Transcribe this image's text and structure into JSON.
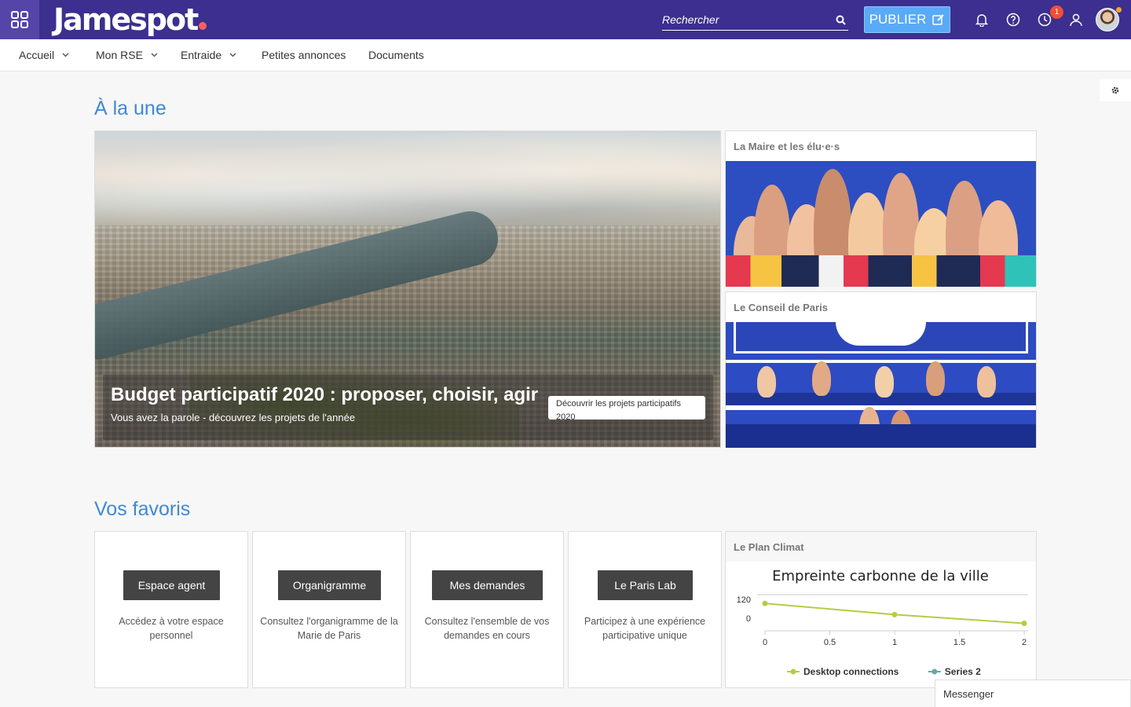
{
  "header": {
    "logo_text": "Jamespot",
    "search_placeholder": "Rechercher",
    "publish_label": "PUBLIER",
    "notif_count": "1",
    "colors": {
      "topbar": "#3c2f8f",
      "accent": "#3f88d6",
      "publish": "#59aaf7",
      "badge": "#f04e37"
    }
  },
  "nav": {
    "items": [
      {
        "label": "Accueil",
        "dropdown": true
      },
      {
        "label": "Mon RSE",
        "dropdown": true
      },
      {
        "label": "Entraide",
        "dropdown": true
      },
      {
        "label": "Petites annonces",
        "dropdown": false
      },
      {
        "label": "Documents",
        "dropdown": false
      }
    ]
  },
  "une": {
    "title": "À la une",
    "hero": {
      "title": "Budget participatif 2020 : proposer, choisir, agir",
      "subtitle": "Vous avez la parole - découvrez les projets de l'année",
      "button": "Découvrir les projets participatifs 2020"
    },
    "cards": [
      {
        "title": "La Maire et les élu·e·s"
      },
      {
        "title": "Le Conseil de Paris"
      }
    ]
  },
  "favoris": {
    "title": "Vos favoris",
    "items": [
      {
        "button": "Espace agent",
        "description": "Accédez à votre espace personnel"
      },
      {
        "button": "Organigramme",
        "description": "Consultez l'organigramme de la Marie de Paris"
      },
      {
        "button": "Mes demandes",
        "description": "Consultez l'ensemble de vos demandes en cours"
      },
      {
        "button": "Le Paris Lab",
        "description": "Participez à une expérience participative unique"
      }
    ],
    "chart_card_title": "Le Plan Climat"
  },
  "chart_data": {
    "type": "line",
    "title": "Empreinte carbonne de la ville",
    "xlabel": "",
    "ylabel": "",
    "x_ticks": [
      "0",
      "0.5",
      "1",
      "1.5",
      "2"
    ],
    "y_ticks": [
      "120",
      "0"
    ],
    "xlim": [
      0,
      2
    ],
    "grid": false,
    "legend_position": "bottom",
    "series": [
      {
        "name": "Desktop connections",
        "color": "#b5cc45",
        "points": [
          [
            0,
            220
          ],
          [
            1,
            130
          ],
          [
            2,
            60
          ]
        ]
      },
      {
        "name": "Series 2",
        "color": "#6aa8a4",
        "points": []
      }
    ]
  },
  "messenger": {
    "label": "Messenger"
  }
}
